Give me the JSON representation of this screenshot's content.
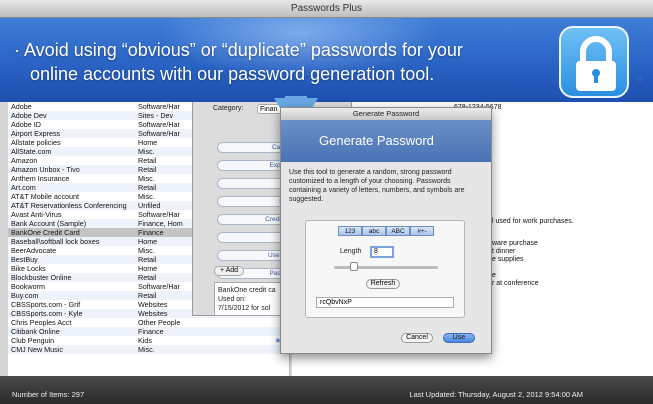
{
  "window": {
    "title": "Passwords Plus"
  },
  "banner": {
    "line1": "· Avoid using “obvious” or “duplicate” passwords for your",
    "line2": "online accounts with our password generation tool."
  },
  "list": {
    "rows": [
      {
        "name": "Adobe",
        "category": "Software/Har",
        "starred": false
      },
      {
        "name": "Adobe Dev",
        "category": "Sites - Dev",
        "starred": false
      },
      {
        "name": "Adobe ID",
        "category": "Software/Har",
        "starred": false
      },
      {
        "name": "Airport Express",
        "category": "Software/Har",
        "starred": false
      },
      {
        "name": "Allstate policies",
        "category": "Home",
        "starred": false
      },
      {
        "name": "AllState.com",
        "category": "Misc.",
        "starred": false
      },
      {
        "name": "Amazon",
        "category": "Retail",
        "starred": false
      },
      {
        "name": "Amazon Unbox - Tivo",
        "category": "Retail",
        "starred": false
      },
      {
        "name": "Anthem Insurance",
        "category": "Misc.",
        "starred": false
      },
      {
        "name": "Art.com",
        "category": "Retail",
        "starred": false
      },
      {
        "name": "AT&T Mobile account",
        "category": "Misc.",
        "starred": false
      },
      {
        "name": "AT&T Reservationless Conferencing",
        "category": "Unfiled",
        "starred": false
      },
      {
        "name": "Avast Anti-Virus",
        "category": "Software/Har",
        "starred": false
      },
      {
        "name": "Bank Account (Sample)",
        "category": "Finance, Hom",
        "starred": false
      },
      {
        "name": "BankOne Credit Card",
        "category": "Finance",
        "starred": false,
        "selected": true
      },
      {
        "name": "Baseball\\softball lock boxes",
        "category": "Home",
        "starred": false
      },
      {
        "name": "BeerAdvocate",
        "category": "Misc.",
        "starred": false
      },
      {
        "name": "BestBuy",
        "category": "Retail",
        "starred": false
      },
      {
        "name": "Bike Locks",
        "category": "Home",
        "starred": false
      },
      {
        "name": "Blockbuster Online",
        "category": "Retail",
        "starred": false
      },
      {
        "name": "Bookworm",
        "category": "Software/Har",
        "starred": false
      },
      {
        "name": "Buy.com",
        "category": "Retail",
        "starred": false
      },
      {
        "name": "CBSSports.com - Grif",
        "category": "Websites",
        "starred": false
      },
      {
        "name": "CBSSports.com - Kyle",
        "category": "Websites",
        "starred": false
      },
      {
        "name": "Chris Peoples Acct",
        "category": "Other People",
        "starred": false
      },
      {
        "name": "Citibank Online",
        "category": "Finance",
        "starred": false
      },
      {
        "name": "Club Penguin",
        "category": "Kids",
        "starred": true
      },
      {
        "name": "CMJ New Music",
        "category": "Misc.",
        "starred": false
      }
    ]
  },
  "detail": {
    "category_label": "Category:",
    "category_value": "Finan",
    "fields": [
      "Card No.",
      "Exp. Date",
      "PIN",
      "Phone",
      "Credit Limit",
      "URL",
      "Username",
      "Password"
    ],
    "add_label": "Add",
    "notes_lines": [
      "BankOne credit ca",
      "Used on:",
      "7/15/2012 for sol"
    ]
  },
  "right": {
    "phone": "678-1234-5678",
    "lines": [
      "l used for work purchases.",
      "ware purchase",
      "t dinner",
      "e supplies",
      "e",
      "r at conference"
    ]
  },
  "dialog": {
    "title": "Generate Password",
    "header": "Generate Password",
    "description": "Use this tool to generate a random, strong password customized to a length of your choosing. Passwords containing a variety of letters, numbers, and symbols are suggested.",
    "segments": [
      "123",
      "abc",
      "ABC",
      "#+-"
    ],
    "length_label": "Length",
    "length_value": "8",
    "slider_level": 0.17,
    "refresh_label": "Refresh",
    "password": "rcQbvNxP",
    "cancel_label": "Cancel",
    "use_label": "Use"
  },
  "status": {
    "items_label": "Number of Items: 297",
    "updated_label": "Last Updated: Thursday, August 2, 2012 9:54:00 AM"
  },
  "watermark": {
    "text": "当下软件园",
    "url": "www.downxia.com"
  }
}
